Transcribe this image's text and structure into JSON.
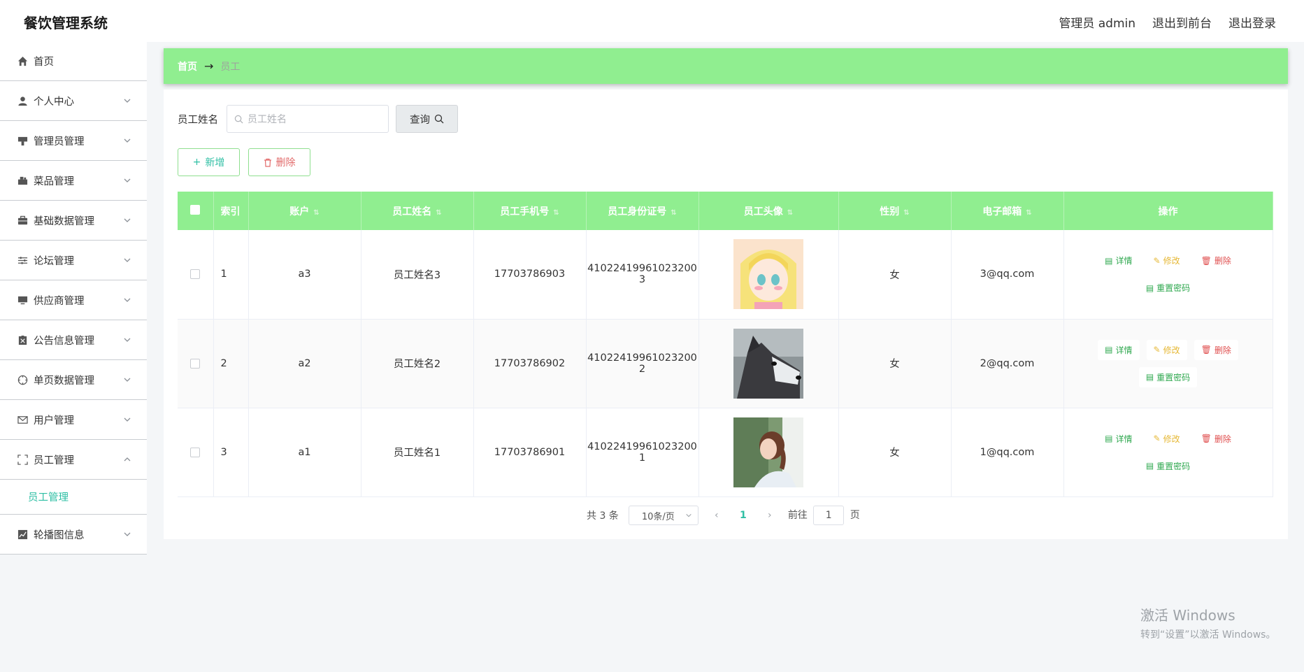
{
  "app": {
    "title": "餐饮管理系统",
    "user_label": "管理员 admin",
    "to_front": "退出到前台",
    "logout": "退出登录"
  },
  "sidebar": {
    "items": [
      {
        "label": "首页",
        "icon": "home-icon"
      },
      {
        "label": "个人中心",
        "icon": "user-icon"
      },
      {
        "label": "管理员管理",
        "icon": "admin-icon"
      },
      {
        "label": "菜品管理",
        "icon": "dish-icon"
      },
      {
        "label": "基础数据管理",
        "icon": "briefcase-icon"
      },
      {
        "label": "论坛管理",
        "icon": "sliders-icon"
      },
      {
        "label": "供应商管理",
        "icon": "monitor-icon"
      },
      {
        "label": "公告信息管理",
        "icon": "notice-icon"
      },
      {
        "label": "单页数据管理",
        "icon": "compass-icon"
      },
      {
        "label": "用户管理",
        "icon": "mail-icon"
      },
      {
        "label": "员工管理",
        "icon": "frame-icon"
      },
      {
        "label": "轮播图信息",
        "icon": "chart-icon"
      }
    ],
    "sub_active": "员工管理"
  },
  "breadcrumb": {
    "home": "首页",
    "arrow": "→",
    "current": "员工"
  },
  "search": {
    "label": "员工姓名",
    "placeholder": "员工姓名",
    "query_label": "查询"
  },
  "actions": {
    "add_label": "新增",
    "delete_label": "删除"
  },
  "table": {
    "headers": [
      "索引",
      "账户",
      "员工姓名",
      "员工手机号",
      "员工身份证号",
      "员工头像",
      "性别",
      "电子邮箱",
      "操作"
    ],
    "rows": [
      {
        "index": "1",
        "account": "a3",
        "name": "员工姓名3",
        "phone": "17703786903",
        "id_no_1": "41022419961023200",
        "id_no_2": "3",
        "avatar": "anime-girl-avatar",
        "gender": "女",
        "email": "3@qq.com"
      },
      {
        "index": "2",
        "account": "a2",
        "name": "员工姓名2",
        "phone": "17703786902",
        "id_no_1": "41022419961023200",
        "id_no_2": "2",
        "avatar": "husky-dog-avatar",
        "gender": "女",
        "email": "2@qq.com"
      },
      {
        "index": "3",
        "account": "a1",
        "name": "员工姓名1",
        "phone": "17703786901",
        "id_no_1": "41022419961023200",
        "id_no_2": "1",
        "avatar": "girl-portrait-avatar",
        "gender": "女",
        "email": "1@qq.com"
      }
    ],
    "ops": {
      "detail": "详情",
      "edit": "修改",
      "delete": "删除",
      "reset": "重置密码"
    }
  },
  "pager": {
    "total": "共 3 条",
    "page_size": "10条/页",
    "current": "1",
    "goto_prefix": "前往",
    "goto_value": "1",
    "goto_suffix": "页"
  },
  "watermark": {
    "line1": "激活 Windows",
    "line2": "转到“设置”以激活 Windows。"
  },
  "colors": {
    "accent_green": "#90ee90",
    "teal": "#2fbfa4",
    "danger": "#e05050",
    "warning": "#e6b836"
  }
}
